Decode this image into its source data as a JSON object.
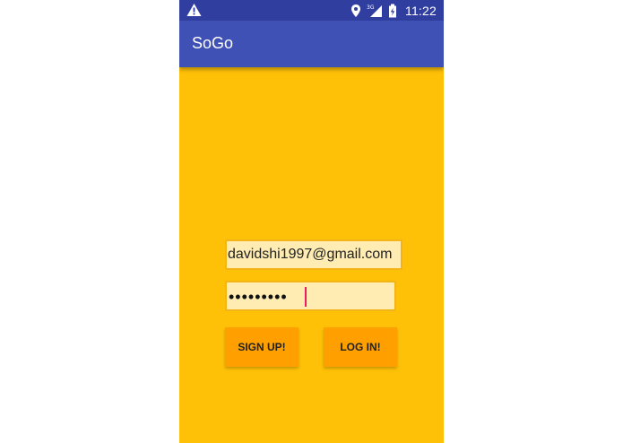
{
  "status_bar": {
    "time": "11:22",
    "network_label": "3G",
    "icons": [
      "warning-icon",
      "location-icon",
      "signal-icon",
      "battery-icon"
    ]
  },
  "app_bar": {
    "title": "SoGo"
  },
  "login_form": {
    "email_value": "davidshi1997@gmail.com",
    "password_masked": "•••••••••",
    "signup_label": "SIGN UP!",
    "login_label": "LOG IN!"
  },
  "colors": {
    "status_bar": "#303F9F",
    "app_bar": "#3F51B5",
    "background": "#FFC107",
    "field_background": "#FFECB3",
    "button": "#FFA000",
    "cursor": "#E91E63"
  }
}
